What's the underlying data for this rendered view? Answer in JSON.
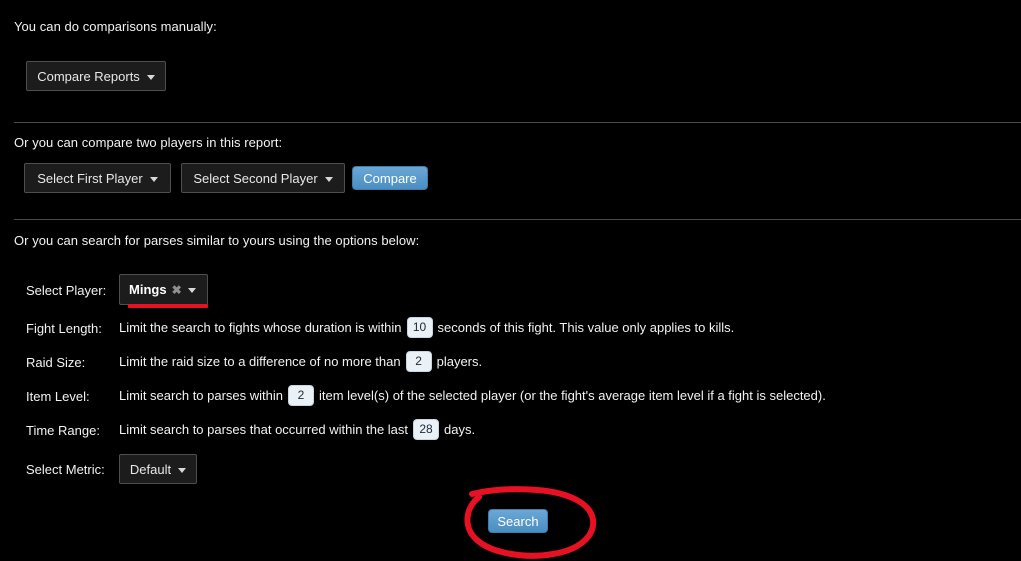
{
  "sections": {
    "manual": {
      "lead": "You can do comparisons manually:",
      "compare_reports_label": "Compare Reports"
    },
    "two_players": {
      "lead": "Or you can compare two players in this report:",
      "first_player_label": "Select First Player",
      "second_player_label": "Select Second Player",
      "compare_button_label": "Compare"
    },
    "similar_search": {
      "lead": "Or you can search for parses similar to yours using the options below:",
      "select_player": {
        "label": "Select Player:",
        "selected_tag": "Mings",
        "remove_glyph": "✖"
      },
      "rows": [
        {
          "label": "Fight Length:",
          "text_before": "Limit the search to fights whose duration is within",
          "value": "10",
          "text_after": "seconds of this fight. This value only applies to kills."
        },
        {
          "label": "Raid Size:",
          "text_before": "Limit the raid size to a difference of no more than",
          "value": "2",
          "text_after": "players."
        },
        {
          "label": "Item Level:",
          "text_before": "Limit search to parses within",
          "value": "2",
          "text_after": "item level(s) of the selected player (or the fight's average item level if a fight is selected)."
        },
        {
          "label": "Time Range:",
          "text_before": "Limit search to parses that occurred within the last",
          "value": "28",
          "text_after": "days."
        }
      ],
      "select_metric": {
        "label": "Select Metric:",
        "selected": "Default"
      },
      "search_button_label": "Search"
    }
  },
  "annotations": {
    "underline_color": "#e81123",
    "ellipse_color": "#e81123"
  },
  "theme": {
    "background": "#000000",
    "text": "#f2f2f2",
    "accent_blue": "#4a8ec2",
    "border": "#4e4e4e"
  }
}
